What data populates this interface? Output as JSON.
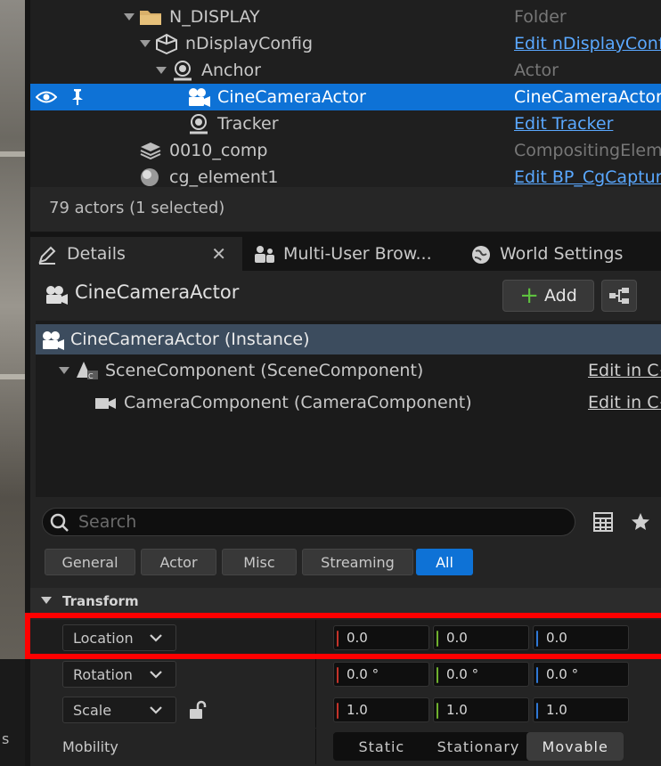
{
  "outliner": {
    "rows": [
      {
        "name": "N_DISPLAY",
        "type": "Folder"
      },
      {
        "name": "nDisplayConfig",
        "type": "Edit nDisplayConfi"
      },
      {
        "name": "Anchor",
        "type": "Actor"
      },
      {
        "name": "CineCameraActor",
        "type": "CineCameraActor"
      },
      {
        "name": "Tracker",
        "type": "Edit Tracker"
      },
      {
        "name": "0010_comp",
        "type": "CompositingEleme"
      },
      {
        "name": "cg_element1",
        "type": "Edit BP_CgCapture"
      }
    ],
    "status": "79 actors (1 selected)"
  },
  "tabs": [
    {
      "label": "Details"
    },
    {
      "label": "Multi-User Brow..."
    },
    {
      "label": "World Settings"
    }
  ],
  "details": {
    "actor_name": "CineCameraActor",
    "add_label": "Add",
    "components": [
      {
        "name": "CineCameraActor (Instance)",
        "edit": ""
      },
      {
        "name": "SceneComponent (SceneComponent)",
        "edit": "Edit in C+"
      },
      {
        "name": "CameraComponent (CameraComponent)",
        "edit": "Edit in C+"
      }
    ],
    "search_placeholder": "Search",
    "filters": [
      "General",
      "Actor",
      "Misc",
      "Streaming",
      "All"
    ],
    "active_filter": "All",
    "category": "Transform",
    "location": {
      "label": "Location",
      "x": "0.0",
      "y": "0.0",
      "z": "0.0"
    },
    "rotation": {
      "label": "Rotation",
      "x": "0.0 °",
      "y": "0.0 °",
      "z": "0.0 °"
    },
    "scale": {
      "label": "Scale",
      "x": "1.0",
      "y": "1.0",
      "z": "1.0"
    },
    "mobility": {
      "label": "Mobility",
      "options": [
        "Static",
        "Stationary",
        "Movable"
      ],
      "selected": "Movable"
    }
  },
  "viewport": {
    "edge_text": "s"
  },
  "colors": {
    "accent": "#0e72d6",
    "x_axis": "#c4332a",
    "y_axis": "#6fb02e",
    "z_axis": "#2f78d6",
    "highlight": "#ff0000"
  }
}
